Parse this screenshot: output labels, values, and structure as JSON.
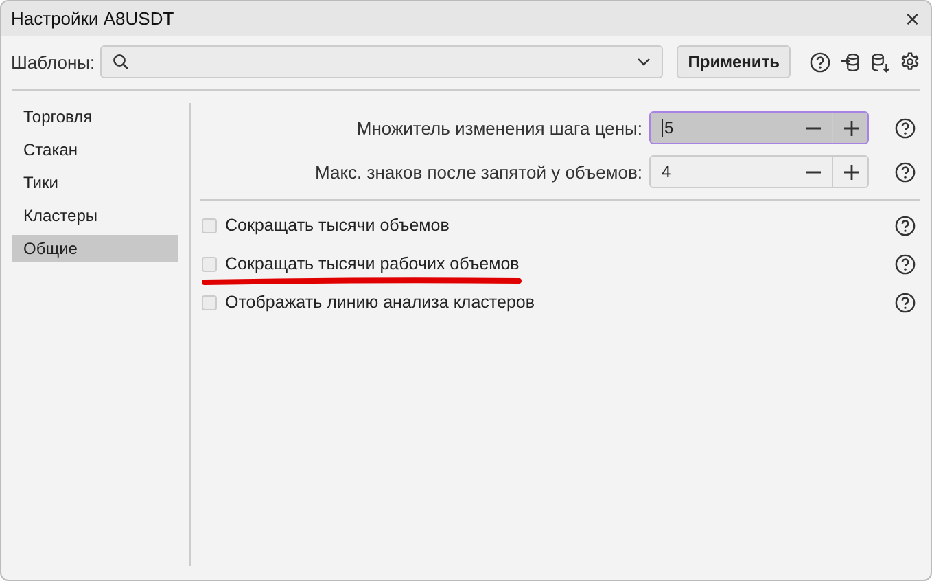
{
  "window": {
    "title": "Настройки A8USDT",
    "close": "×"
  },
  "templates": {
    "label": "Шаблоны:",
    "apply": "Применить"
  },
  "sidebar": {
    "items": [
      {
        "label": "Торговля",
        "selected": false
      },
      {
        "label": "Стакан",
        "selected": false
      },
      {
        "label": "Тики",
        "selected": false
      },
      {
        "label": "Кластеры",
        "selected": false
      },
      {
        "label": "Общие",
        "selected": true
      }
    ]
  },
  "fields": [
    {
      "label": "Множитель изменения шага цены:",
      "value": "5",
      "focused": true
    },
    {
      "label": "Макс. знаков после запятой у объемов:",
      "value": "4",
      "focused": false
    }
  ],
  "options": [
    {
      "label": "Сокращать тысячи объемов",
      "checked": false,
      "underlined": false
    },
    {
      "label": "Сокращать тысячи рабочих объемов",
      "checked": false,
      "underlined": true
    },
    {
      "label": "Отображать линию анализа кластеров",
      "checked": false,
      "underlined": false
    }
  ]
}
